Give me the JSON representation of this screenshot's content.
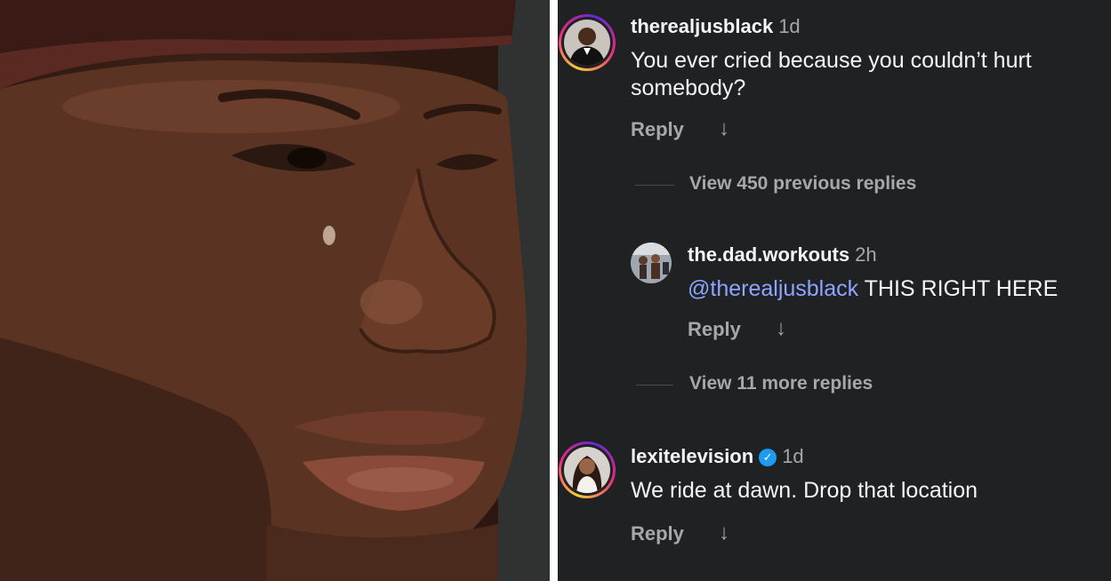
{
  "comments": [
    {
      "username": "therealjusblack",
      "time": "1d",
      "text": "You ever cried because you couldn’t hurt somebody?",
      "reply_label": "Reply",
      "view_replies_label": "View 450 previous replies"
    },
    {
      "username": "the.dad.workouts",
      "time": "2h",
      "mention": "@therealjusblack",
      "text": "THIS RIGHT HERE",
      "reply_label": "Reply",
      "view_replies_label": "View 11 more replies"
    },
    {
      "username": "lexitelevision",
      "verified": true,
      "time": "1d",
      "text": "We ride at dawn. Drop that location",
      "reply_label": "Reply"
    }
  ],
  "icons": {
    "reply_arrow": "arrow-down-icon",
    "verified": "verified-badge-icon"
  },
  "colors": {
    "panel_bg": "#202123",
    "mention": "#8ea5ff",
    "verified": "#1d9bf0",
    "muted_text": "#a8a8a8"
  }
}
